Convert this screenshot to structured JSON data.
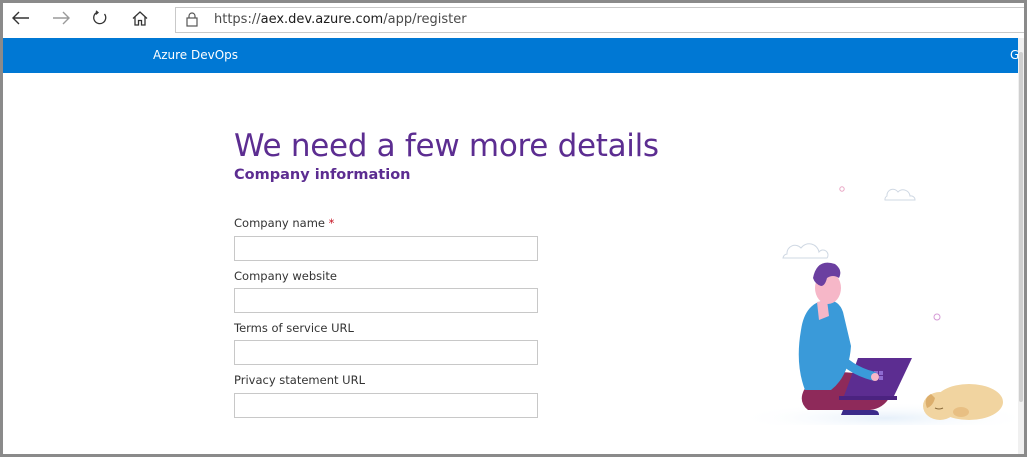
{
  "browser": {
    "url_prefix": "https://",
    "url_domain": "aex.dev.azure.com",
    "url_path": "/app/register"
  },
  "header": {
    "title": "Azure DevOps",
    "right_clipped": "G"
  },
  "main": {
    "title": "We need a few more details",
    "section": "Company information",
    "fields": [
      {
        "label": "Company name",
        "required_marker": "*",
        "value": "",
        "placeholder": ""
      },
      {
        "label": "Company website",
        "value": "",
        "placeholder": ""
      },
      {
        "label": "Terms of service URL",
        "value": "",
        "placeholder": ""
      },
      {
        "label": "Privacy statement URL",
        "value": "",
        "placeholder": ""
      }
    ]
  },
  "colors": {
    "header_bg": "#0078d4",
    "title": "#5c2d91",
    "required": "#c50f1f"
  },
  "icons": [
    "back-arrow-icon",
    "forward-arrow-icon",
    "refresh-icon",
    "home-icon",
    "lock-icon"
  ]
}
